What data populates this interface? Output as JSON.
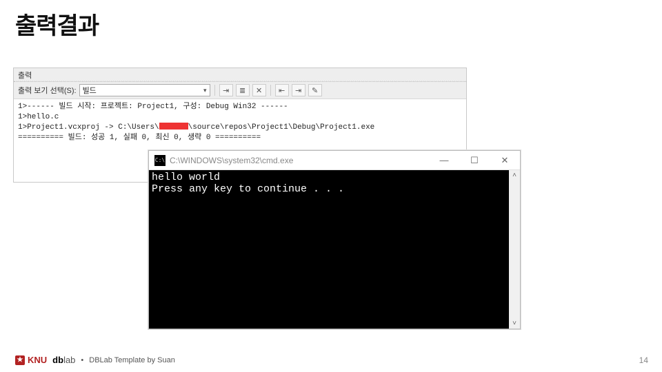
{
  "slide": {
    "title": "출력결과",
    "page_number": "14"
  },
  "vs_output": {
    "panel_title": "출력",
    "show_from_label": "출력 보기 선택(S):",
    "selected_source": "빌드",
    "lines": {
      "l1": "1>------ 빌드 시작: 프로젝트: Project1, 구성: Debug Win32 ------",
      "l2": "1>hello.c",
      "l3a": "1>Project1.vcxproj -> C:\\Users\\",
      "l3b": "\\source\\repos\\Project1\\Debug\\Project1.exe",
      "l4": "========== 빌드: 성공 1, 실패 0, 최신 0, 생략 0 =========="
    }
  },
  "cmd": {
    "title": "C:\\WINDOWS\\system32\\cmd.exe",
    "body": "hello world\nPress any key to continue . . ."
  },
  "footer": {
    "knu": "KNU",
    "dblab_db": "db",
    "dblab_lab": "lab",
    "bullet": "•",
    "credit": "DBLab Template by Suan"
  }
}
